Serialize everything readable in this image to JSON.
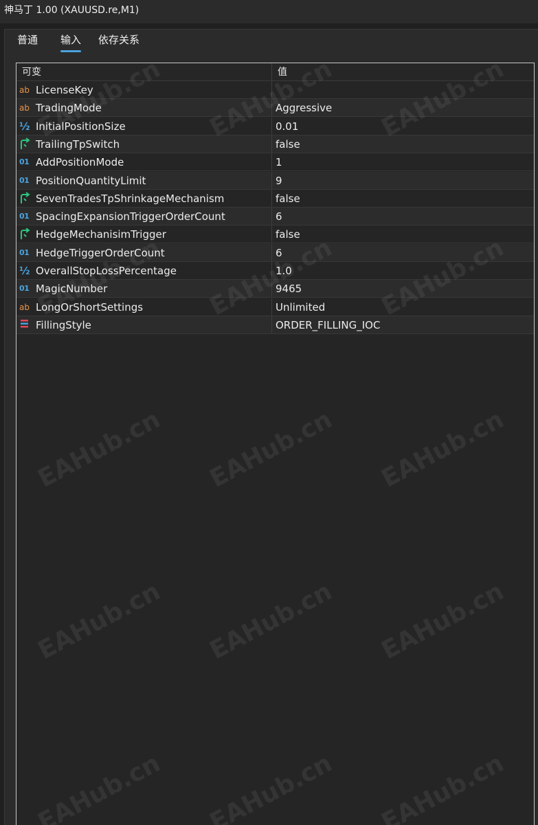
{
  "window": {
    "title": "神马丁 1.00 (XAUUSD.re,M1)"
  },
  "tabs": [
    {
      "label": "普通",
      "active": false
    },
    {
      "label": "输入",
      "active": true
    },
    {
      "label": "依存关系",
      "active": false
    }
  ],
  "grid": {
    "headers": {
      "name": "可变",
      "value": "值"
    },
    "rows": [
      {
        "icon": "string-type-icon",
        "name": "LicenseKey",
        "value": ""
      },
      {
        "icon": "string-type-icon",
        "name": "TradingMode",
        "value": "Aggressive"
      },
      {
        "icon": "double-type-icon",
        "name": "InitialPositionSize",
        "value": "0.01"
      },
      {
        "icon": "bool-type-icon",
        "name": "TrailingTpSwitch",
        "value": "false"
      },
      {
        "icon": "int-type-icon",
        "name": "AddPositionMode",
        "value": "1"
      },
      {
        "icon": "int-type-icon",
        "name": "PositionQuantityLimit",
        "value": "9"
      },
      {
        "icon": "bool-type-icon",
        "name": "SevenTradesTpShrinkageMechanism",
        "value": "false"
      },
      {
        "icon": "int-type-icon",
        "name": "SpacingExpansionTriggerOrderCount",
        "value": "6"
      },
      {
        "icon": "bool-type-icon",
        "name": "HedgeMechanisimTrigger",
        "value": "false"
      },
      {
        "icon": "int-type-icon",
        "name": "HedgeTriggerOrderCount",
        "value": "6"
      },
      {
        "icon": "double-type-icon",
        "name": "OverallStopLossPercentage",
        "value": "1.0"
      },
      {
        "icon": "int-type-icon",
        "name": "MagicNumber",
        "value": "9465"
      },
      {
        "icon": "string-type-icon",
        "name": "LongOrShortSettings",
        "value": "Unlimited"
      },
      {
        "icon": "enum-type-icon",
        "name": "FillingStyle",
        "value": "ORDER_FILLING_IOC"
      }
    ]
  },
  "icon_glyphs": {
    "string": "ab",
    "double": "½",
    "int": "01"
  },
  "watermark": {
    "text": "EAHub.cn"
  },
  "colors": {
    "accent": "#4aa3df",
    "string_icon": "#e8944a",
    "bool_icon": "#2ec27e",
    "enum_icon": "#e04a5a"
  }
}
